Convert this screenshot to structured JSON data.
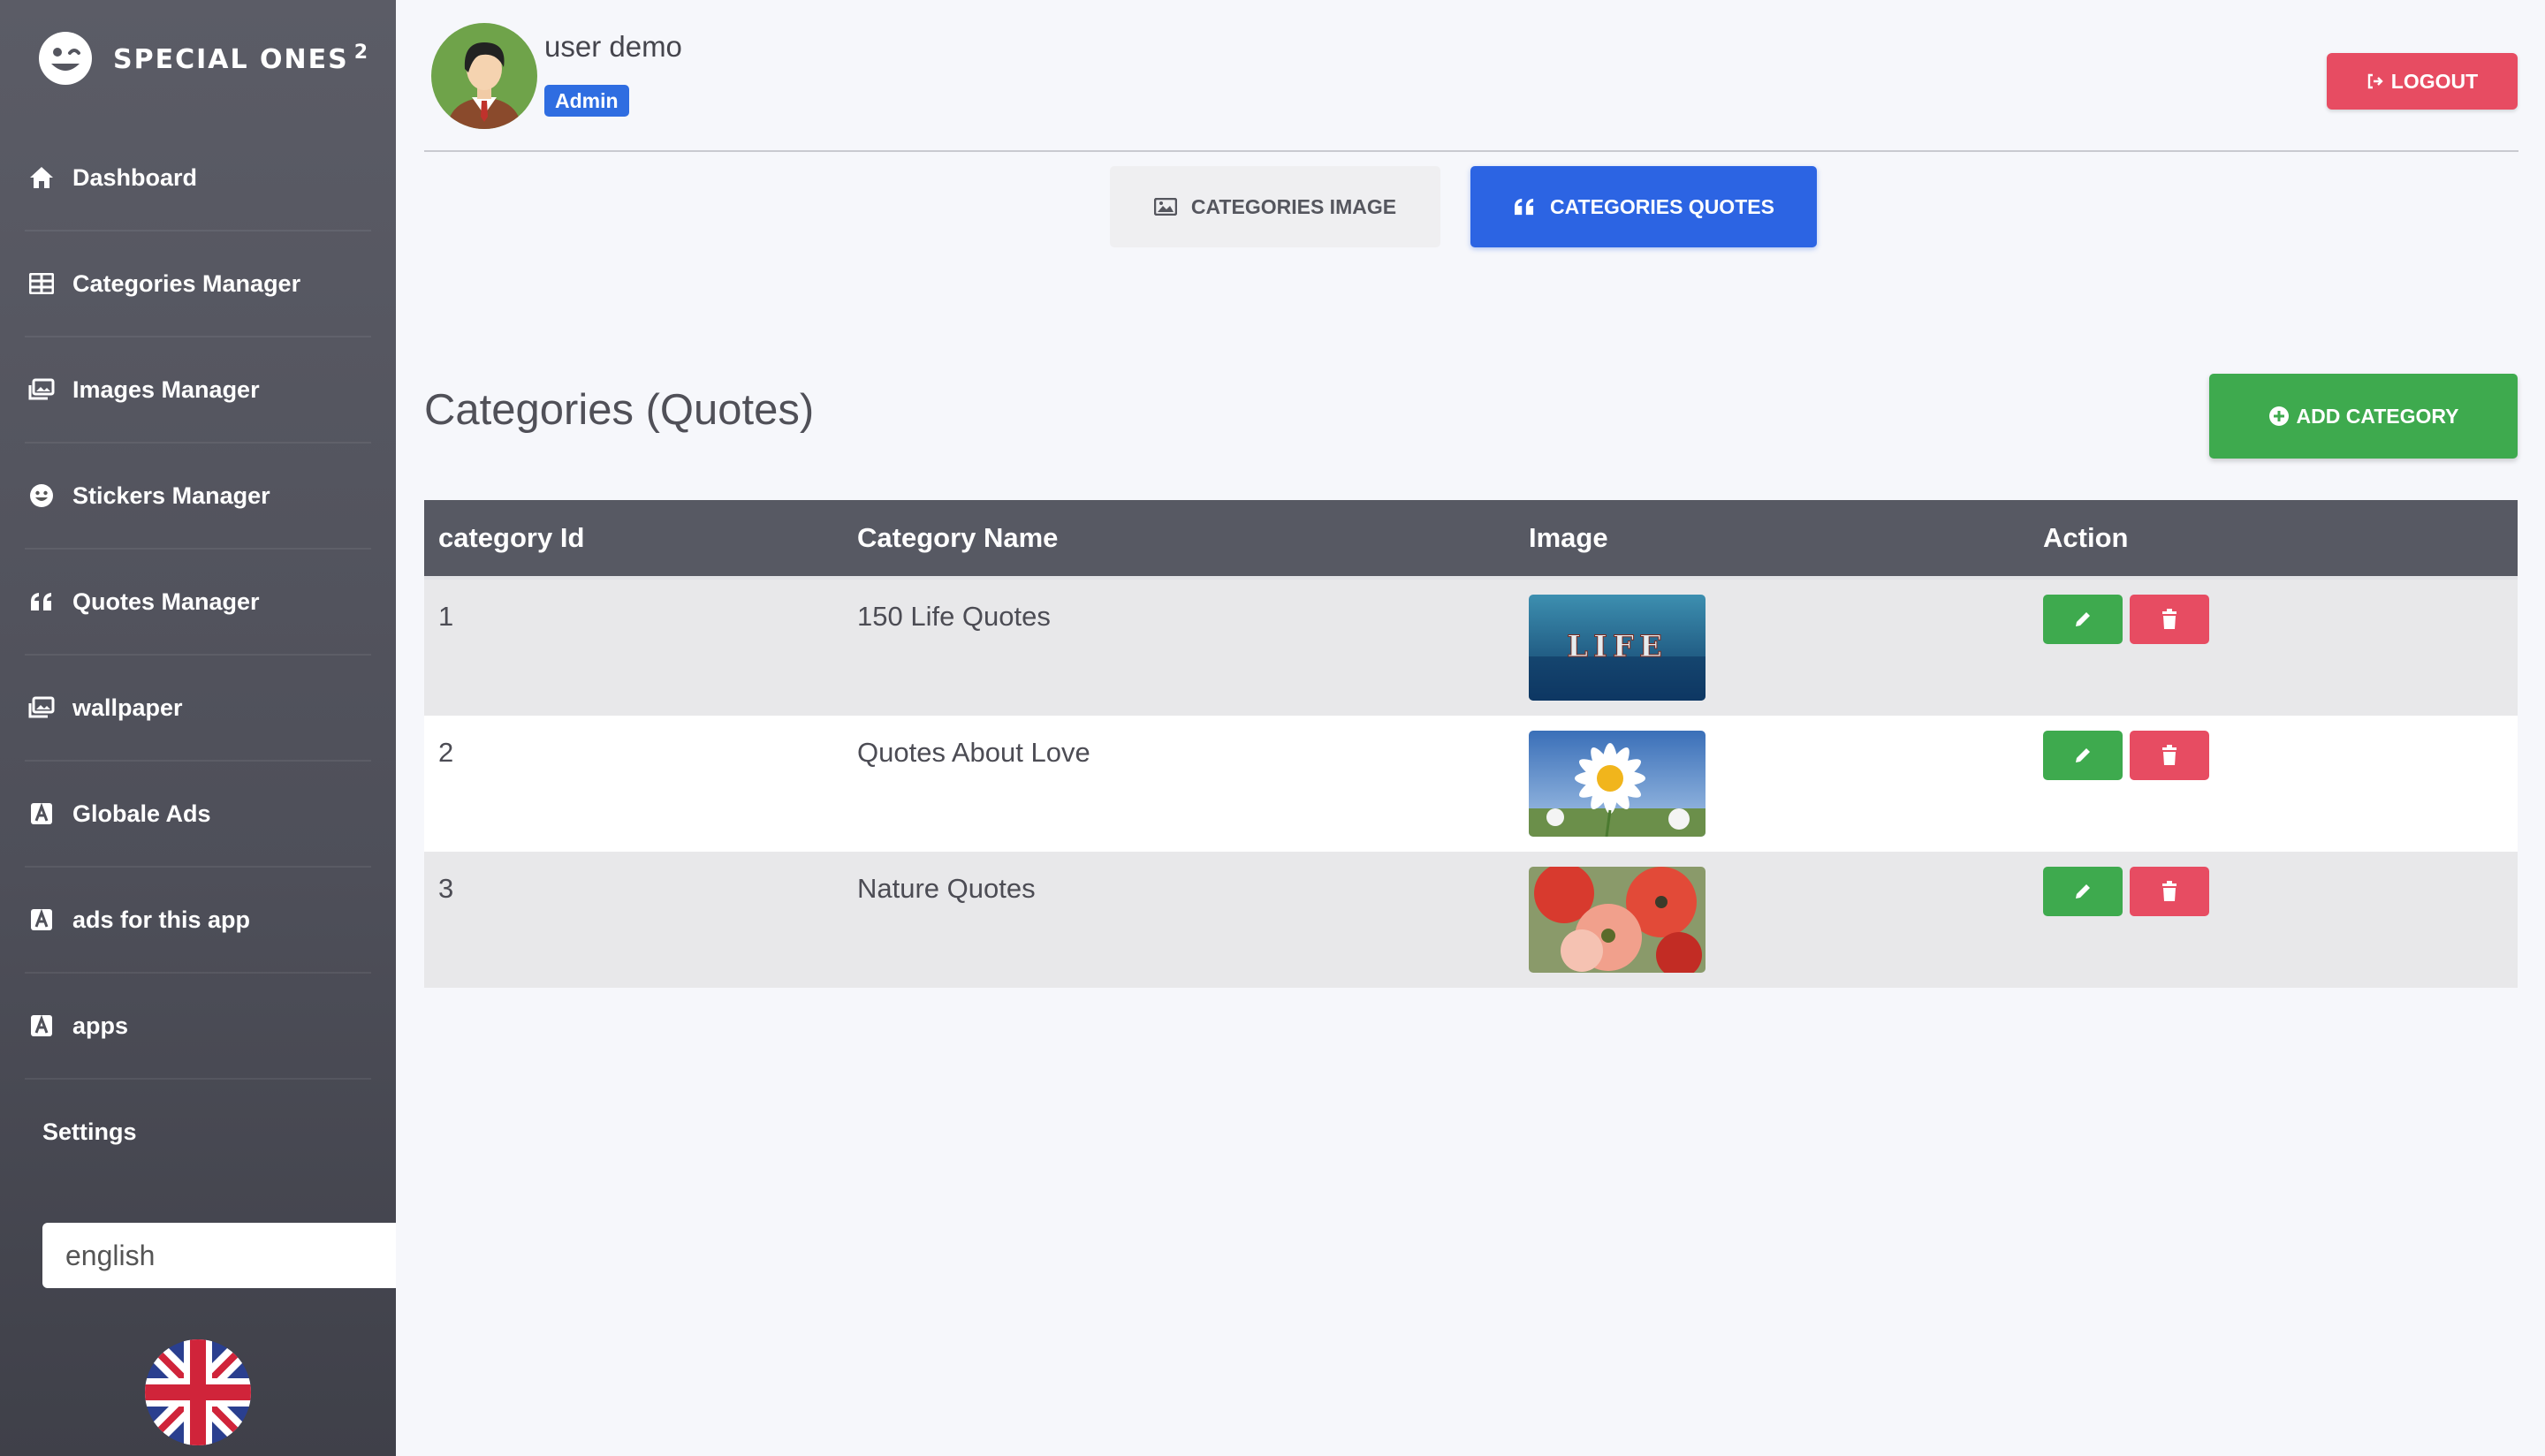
{
  "brand": {
    "name": "SPECIAL ONES",
    "superscript": "2"
  },
  "sidebar": {
    "items": [
      {
        "label": "Dashboard",
        "icon": "home-icon"
      },
      {
        "label": "Categories Manager",
        "icon": "table-icon"
      },
      {
        "label": "Images Manager",
        "icon": "images-icon"
      },
      {
        "label": "Stickers Manager",
        "icon": "smile-icon"
      },
      {
        "label": "Quotes Manager",
        "icon": "quote-icon"
      },
      {
        "label": "wallpaper",
        "icon": "images-icon"
      },
      {
        "label": "Globale Ads",
        "icon": "ad-icon"
      },
      {
        "label": "ads for this app",
        "icon": "ad-icon"
      },
      {
        "label": "apps",
        "icon": "ad-icon"
      },
      {
        "label": "Settings",
        "icon": ""
      }
    ],
    "language": {
      "value": "english",
      "flag": "uk-flag-icon"
    }
  },
  "header": {
    "username": "user demo",
    "role": "Admin",
    "logout_label": "LOGOUT"
  },
  "tabs": [
    {
      "label": "CATEGORIES IMAGE",
      "icon": "image-icon",
      "active": false
    },
    {
      "label": "CATEGORIES QUOTES",
      "icon": "quote-icon",
      "active": true
    }
  ],
  "main": {
    "title": "Categories (Quotes)",
    "add_label": "ADD CATEGORY"
  },
  "table": {
    "columns": [
      "category Id",
      "Category Name",
      "Image",
      "Action"
    ],
    "rows": [
      {
        "id": "1",
        "name": "150 Life Quotes",
        "image": "life-ocean-thumbnail"
      },
      {
        "id": "2",
        "name": "Quotes About Love",
        "image": "daisy-thumbnail"
      },
      {
        "id": "3",
        "name": "Nature Quotes",
        "image": "poppies-thumbnail"
      }
    ]
  },
  "colors": {
    "primary": "#2c64e3",
    "success": "#3eaa4e",
    "danger": "#e74c62",
    "sidebar": "#4e4f59",
    "badge": "#2f6de1"
  }
}
